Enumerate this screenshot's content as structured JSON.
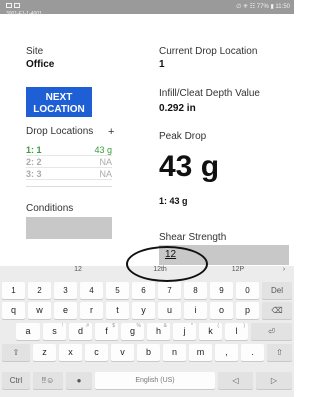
{
  "status": {
    "title": "3001-F1-1-4001",
    "right": "∅ ✳ ☷ 77% ▮ 11:50"
  },
  "site": {
    "label": "Site",
    "value": "Office"
  },
  "current_drop": {
    "label": "Current Drop Location",
    "value": "1"
  },
  "next_button": {
    "line1": "NEXT",
    "line2": "LOCATION"
  },
  "infill": {
    "label": "Infill/Cleat Depth Value",
    "value": "0.292 in"
  },
  "drop_locations": {
    "label": "Drop Locations",
    "add_label": "+",
    "rows": [
      {
        "name": "1: 1",
        "value": "43 g",
        "active": true
      },
      {
        "name": "2: 2",
        "value": "NA",
        "active": false
      },
      {
        "name": "3: 3",
        "value": "NA",
        "active": false
      }
    ]
  },
  "peak_drop": {
    "label": "Peak Drop",
    "value": "43 g",
    "summary": "1: 43 g"
  },
  "conditions": {
    "label": "Conditions"
  },
  "shear": {
    "label": "Shear Strength",
    "value": "12"
  },
  "keyboard": {
    "suggestions": [
      "12",
      "12th",
      "12P",
      "›"
    ],
    "rows": [
      [
        "1",
        "2",
        "3",
        "4",
        "5",
        "6",
        "7",
        "8",
        "9",
        "0",
        "Del"
      ],
      [
        "q",
        "w",
        "e",
        "r",
        "t",
        "y",
        "u",
        "i",
        "o",
        "p",
        "⌫"
      ],
      [
        "a",
        "s",
        "d",
        "f",
        "g",
        "h",
        "j",
        "k",
        "l",
        "⏎"
      ],
      [
        "⇧",
        "z",
        "x",
        "c",
        "v",
        "b",
        "n",
        "m",
        ",",
        ".",
        "⇧"
      ]
    ],
    "row3_hints": [
      "!",
      "#",
      "$",
      "%",
      "&",
      "*",
      "(",
      ")"
    ],
    "bottom": {
      "ctrl": "Ctrl",
      "emoji": "!!☺",
      "mic": "●",
      "space": "English (US)",
      "left": "◁",
      "right": "▷"
    }
  }
}
